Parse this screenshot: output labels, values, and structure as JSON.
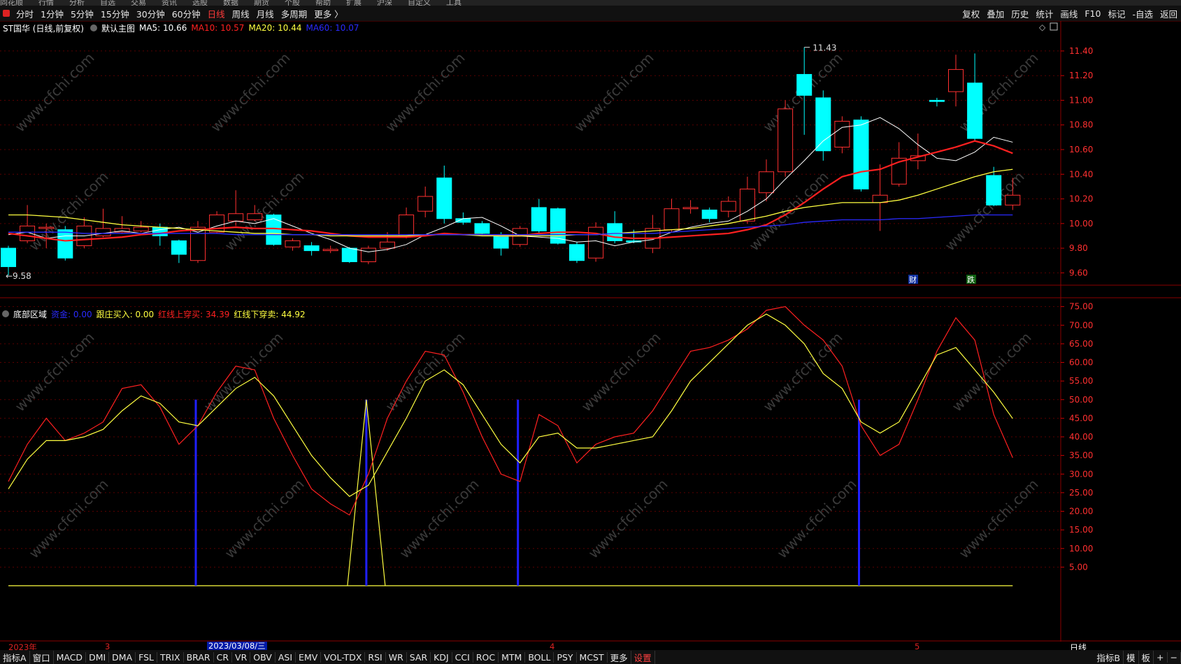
{
  "menubar": [
    "同花顺",
    "行情",
    "分析",
    "自选",
    "交易",
    "资讯",
    "选股",
    "数据",
    "期货",
    "个股",
    "帮助",
    "扩展",
    "沪深",
    "自定义",
    "工具"
  ],
  "toolbar": {
    "left": [
      {
        "label": "分时",
        "active": false
      },
      {
        "label": "1分钟",
        "active": false
      },
      {
        "label": "5分钟",
        "active": false
      },
      {
        "label": "15分钟",
        "active": false
      },
      {
        "label": "30分钟",
        "active": false
      },
      {
        "label": "60分钟",
        "active": false
      },
      {
        "label": "日线",
        "active": true
      },
      {
        "label": "周线",
        "active": false
      },
      {
        "label": "月线",
        "active": false
      },
      {
        "label": "多周期",
        "active": false
      },
      {
        "label": "更多 〉",
        "active": false
      }
    ],
    "right": [
      "复权",
      "叠加",
      "历史",
      "统计",
      "画线",
      "F10",
      "标记",
      "-自选",
      "返回"
    ]
  },
  "main_legend": {
    "stock": "ST国华 (日线,前复权)",
    "template": "默认主图",
    "items": [
      {
        "text": "MA5: 10.66",
        "color": "#ffffff"
      },
      {
        "text": "MA10: 10.57",
        "color": "#ff2020"
      },
      {
        "text": "MA20: 10.44",
        "color": "#ffff40"
      },
      {
        "text": "MA60: 10.07",
        "color": "#2a2aff"
      }
    ]
  },
  "indicator_legend": {
    "name": "底部区域",
    "items": [
      {
        "text": "资金: 0.00",
        "color": "#2a2aff"
      },
      {
        "text": "跟庄买入: 0.00",
        "color": "#ffff40"
      },
      {
        "text": "红线上穿买: 34.39",
        "color": "#ff2020"
      },
      {
        "text": "红线下穿卖: 44.92",
        "color": "#ffff40"
      }
    ]
  },
  "annotations": {
    "high": "11.43",
    "low": "←9.58",
    "cai": "财",
    "die": "跌"
  },
  "watermark": "www.cfchi.com",
  "date_axis": {
    "labels": [
      "2023年",
      "3",
      "4",
      "5"
    ],
    "selected": "2023/03/08/三",
    "period": "日线"
  },
  "bottom_tabs": [
    "指标A",
    "窗口",
    "MACD",
    "DMI",
    "DMA",
    "FSL",
    "TRIX",
    "BRAR",
    "CR",
    "VR",
    "OBV",
    "ASI",
    "EMV",
    "VOL-TDX",
    "RSI",
    "WR",
    "SAR",
    "KDJ",
    "CCI",
    "ROC",
    "MTM",
    "BOLL",
    "PSY",
    "MCST",
    "更多",
    "设置"
  ],
  "bottom_right": [
    "指标B",
    "模",
    "板",
    "+",
    "−"
  ],
  "chart_data": {
    "type": "candlestick",
    "price_ylim": [
      9.5,
      11.53
    ],
    "price_ticks": [
      "11.40",
      "11.20",
      "11.00",
      "10.80",
      "10.60",
      "10.40",
      "10.20",
      "10.00",
      "9.80",
      "9.60"
    ],
    "candles": [
      [
        9.8,
        9.65,
        9.82,
        9.58
      ],
      [
        9.86,
        9.98,
        10.15,
        9.84
      ],
      [
        9.96,
        9.97,
        10.0,
        9.8
      ],
      [
        9.95,
        9.72,
        9.98,
        9.7
      ],
      [
        9.82,
        9.98,
        10.05,
        9.8
      ],
      [
        9.9,
        9.96,
        10.12,
        9.89
      ],
      [
        9.93,
        9.96,
        10.06,
        9.92
      ],
      [
        9.94,
        9.97,
        10.02,
        9.93
      ],
      [
        9.97,
        9.9,
        10.0,
        9.82
      ],
      [
        9.86,
        9.75,
        9.87,
        9.68
      ],
      [
        9.7,
        9.97,
        10.02,
        9.68
      ],
      [
        9.93,
        10.07,
        10.1,
        9.92
      ],
      [
        10.02,
        10.08,
        10.27,
        9.98
      ],
      [
        10.03,
        10.08,
        10.15,
        10.02
      ],
      [
        10.07,
        9.83,
        10.08,
        9.82
      ],
      [
        9.81,
        9.86,
        9.88,
        9.78
      ],
      [
        9.82,
        9.78,
        9.85,
        9.74
      ],
      [
        9.78,
        9.79,
        9.82,
        9.76
      ],
      [
        9.8,
        9.69,
        9.81,
        9.68
      ],
      [
        9.69,
        9.8,
        9.82,
        9.67
      ],
      [
        9.8,
        9.85,
        9.93,
        9.78
      ],
      [
        9.9,
        10.07,
        10.13,
        9.88
      ],
      [
        10.1,
        10.22,
        10.3,
        10.05
      ],
      [
        10.37,
        10.04,
        10.47,
        10.0
      ],
      [
        10.04,
        10.01,
        10.09,
        9.99
      ],
      [
        10.0,
        9.92,
        10.02,
        9.9
      ],
      [
        9.91,
        9.8,
        9.93,
        9.74
      ],
      [
        9.83,
        9.96,
        9.98,
        9.81
      ],
      [
        10.13,
        9.94,
        10.2,
        9.92
      ],
      [
        10.12,
        9.84,
        10.13,
        9.83
      ],
      [
        9.83,
        9.7,
        9.85,
        9.68
      ],
      [
        9.72,
        9.97,
        10.01,
        9.69
      ],
      [
        10.0,
        9.86,
        10.1,
        9.84
      ],
      [
        9.86,
        9.85,
        9.95,
        9.84
      ],
      [
        9.8,
        9.96,
        10.07,
        9.76
      ],
      [
        9.95,
        10.12,
        10.2,
        9.93
      ],
      [
        10.12,
        10.13,
        10.19,
        10.08
      ],
      [
        10.11,
        10.04,
        10.13,
        10.01
      ],
      [
        10.1,
        10.18,
        10.22,
        10.05
      ],
      [
        10.02,
        10.28,
        10.38,
        10.0
      ],
      [
        10.25,
        10.42,
        10.52,
        10.18
      ],
      [
        10.42,
        10.93,
        11.0,
        10.38
      ],
      [
        11.21,
        11.04,
        11.43,
        10.72
      ],
      [
        11.02,
        10.59,
        11.08,
        10.51
      ],
      [
        10.62,
        10.83,
        10.87,
        10.57
      ],
      [
        10.84,
        10.28,
        10.87,
        10.26
      ],
      [
        10.17,
        10.23,
        10.48,
        9.94
      ],
      [
        10.32,
        10.53,
        10.66,
        10.3
      ],
      [
        10.51,
        10.55,
        10.73,
        10.44
      ],
      [
        11.0,
        10.99,
        11.02,
        10.95
      ],
      [
        11.07,
        11.25,
        11.37,
        10.95
      ],
      [
        11.14,
        10.69,
        11.38,
        10.67
      ],
      [
        10.39,
        10.15,
        10.46,
        10.14
      ],
      [
        10.15,
        10.23,
        10.37,
        10.11
      ]
    ],
    "ma": {
      "MA5": [
        9.91,
        9.93,
        9.88,
        9.9,
        9.9,
        9.92,
        9.94,
        9.92,
        9.95,
        9.97,
        9.93,
        9.98,
        10.02,
        10.0,
        10.04,
        9.98,
        9.92,
        9.87,
        9.8,
        9.77,
        9.79,
        9.83,
        9.91,
        9.97,
        10.04,
        10.05,
        9.98,
        9.9,
        9.89,
        9.88,
        9.85,
        9.86,
        9.82,
        9.85,
        9.87,
        9.93,
        9.97,
        10.0,
        10.02,
        10.1,
        10.2,
        10.36,
        10.51,
        10.67,
        10.78,
        10.8,
        10.86,
        10.77,
        10.64,
        10.53,
        10.51,
        10.58,
        10.7,
        10.66
      ],
      "MA10": [
        9.92,
        9.9,
        9.88,
        9.86,
        9.87,
        9.88,
        9.89,
        9.91,
        9.92,
        9.94,
        9.95,
        9.96,
        9.97,
        9.96,
        9.96,
        9.95,
        9.94,
        9.92,
        9.9,
        9.89,
        9.89,
        9.89,
        9.9,
        9.92,
        9.91,
        9.91,
        9.9,
        9.9,
        9.92,
        9.93,
        9.93,
        9.92,
        9.89,
        9.88,
        9.88,
        9.89,
        9.9,
        9.91,
        9.92,
        9.95,
        9.99,
        10.07,
        10.17,
        10.28,
        10.38,
        10.42,
        10.44,
        10.5,
        10.54,
        10.58,
        10.62,
        10.67,
        10.63,
        10.57
      ],
      "MA20": [
        10.07,
        10.07,
        10.06,
        10.05,
        10.03,
        10.01,
        9.99,
        9.98,
        9.97,
        9.96,
        9.95,
        9.94,
        9.93,
        9.92,
        9.92,
        9.91,
        9.91,
        9.9,
        9.9,
        9.9,
        9.9,
        9.9,
        9.91,
        9.91,
        9.91,
        9.9,
        9.9,
        9.9,
        9.9,
        9.9,
        9.91,
        9.91,
        9.92,
        9.93,
        9.94,
        9.95,
        9.96,
        9.98,
        10.0,
        10.03,
        10.06,
        10.1,
        10.13,
        10.15,
        10.17,
        10.17,
        10.17,
        10.19,
        10.23,
        10.28,
        10.33,
        10.38,
        10.42,
        10.44
      ],
      "MA60": [
        9.93,
        9.93,
        9.93,
        9.93,
        9.92,
        9.92,
        9.92,
        9.92,
        9.92,
        9.92,
        9.92,
        9.92,
        9.91,
        9.91,
        9.91,
        9.91,
        9.91,
        9.91,
        9.91,
        9.91,
        9.91,
        9.91,
        9.91,
        9.91,
        9.91,
        9.91,
        9.91,
        9.91,
        9.91,
        9.91,
        9.91,
        9.91,
        9.92,
        9.92,
        9.92,
        9.93,
        9.94,
        9.95,
        9.96,
        9.97,
        9.98,
        9.99,
        10.01,
        10.02,
        10.03,
        10.03,
        10.03,
        10.04,
        10.04,
        10.05,
        10.06,
        10.07,
        10.07,
        10.07
      ]
    },
    "indicator_ylim": [
      0,
      77
    ],
    "indicator_ticks": [
      "75.00",
      "70.00",
      "65.00",
      "60.00",
      "55.00",
      "50.00",
      "45.00",
      "40.00",
      "35.00",
      "30.00",
      "25.00",
      "20.00",
      "15.00",
      "10.00",
      "5.00"
    ],
    "indicator_series": {
      "red": [
        28,
        38,
        45,
        39,
        41,
        44,
        53,
        54,
        48,
        38,
        43,
        52,
        59,
        58,
        45,
        35,
        26,
        22,
        19,
        30,
        45,
        55,
        63,
        62,
        52,
        40,
        30,
        28,
        46,
        43,
        33,
        38,
        40,
        41,
        47,
        55,
        63,
        64,
        66,
        69,
        74,
        75,
        70,
        66,
        59,
        43,
        35,
        38,
        50,
        63,
        72,
        66,
        46,
        34.39
      ],
      "yellow": [
        26,
        34,
        39,
        39,
        40,
        42,
        47,
        51,
        49,
        44,
        43,
        48,
        53,
        56,
        51,
        43,
        35,
        29,
        24,
        27,
        36,
        45,
        55,
        58,
        54,
        46,
        38,
        33,
        40,
        41,
        37,
        37,
        38,
        39,
        40,
        47,
        55,
        60,
        65,
        70,
        73,
        70,
        65,
        57,
        53,
        44,
        41,
        44,
        53,
        62,
        64,
        58,
        52,
        44.92
      ]
    },
    "signals": {
      "blue_bars": [
        {
          "index": 10,
          "value": 50
        },
        {
          "index": 19,
          "value": 50
        },
        {
          "index": 27,
          "value": 50
        },
        {
          "index": 45,
          "value": 50
        }
      ],
      "yellow_spike": {
        "index": 19,
        "value": 50
      }
    }
  }
}
